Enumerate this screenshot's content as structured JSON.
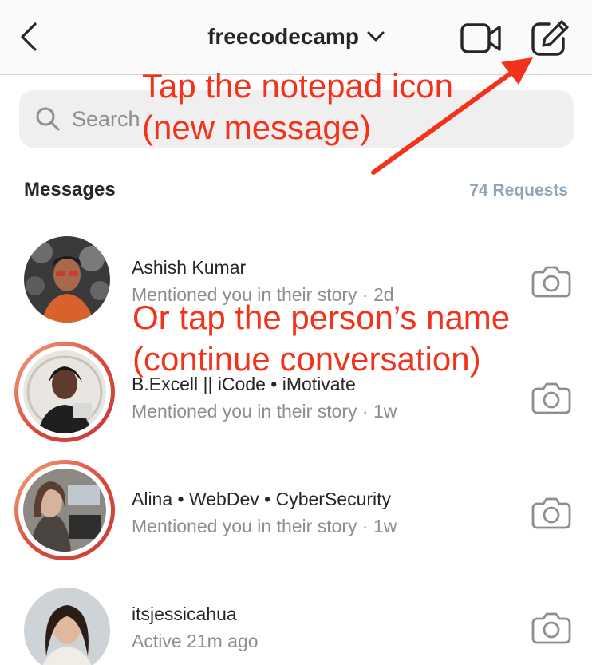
{
  "header": {
    "account_name": "freecodecamp",
    "icons": {
      "back": "chevron-left-icon",
      "account_switch": "chevron-down-icon",
      "video_call": "video-camera-icon",
      "new_message": "compose-notepad-icon"
    }
  },
  "search": {
    "placeholder": "Search",
    "icon": "search-icon"
  },
  "messages_section": {
    "title": "Messages",
    "requests_label": "74 Requests"
  },
  "conversations": [
    {
      "name": "Ashish Kumar",
      "preview": "Mentioned you in their story · 2d",
      "has_story_ring": false,
      "camera_icon": "camera-icon"
    },
    {
      "name": "B.Excell || iCode • iMotivate",
      "preview": "Mentioned you in their story · 1w",
      "has_story_ring": true,
      "camera_icon": "camera-icon"
    },
    {
      "name": "Alina • WebDev • CyberSecurity",
      "preview": "Mentioned you in their story · 1w",
      "has_story_ring": true,
      "camera_icon": "camera-icon"
    },
    {
      "name": "itsjessicahua",
      "preview": "Active 21m ago",
      "has_story_ring": false,
      "camera_icon": "camera-icon"
    }
  ],
  "annotations": {
    "compose_hint_line1": "Tap the notepad icon",
    "compose_hint_line2": "(new message)",
    "conversation_hint_line1": "Or tap the person’s name",
    "conversation_hint_line2": "(continue conversation)",
    "color": "#f2321a"
  },
  "colors": {
    "header_bg": "#fafafa",
    "search_bg": "#efefef",
    "requests_text": "#8fa4b8",
    "secondary_text": "#8e8e8e",
    "story_ring_start": "#f2a37d",
    "story_ring_end": "#c73c3c"
  }
}
